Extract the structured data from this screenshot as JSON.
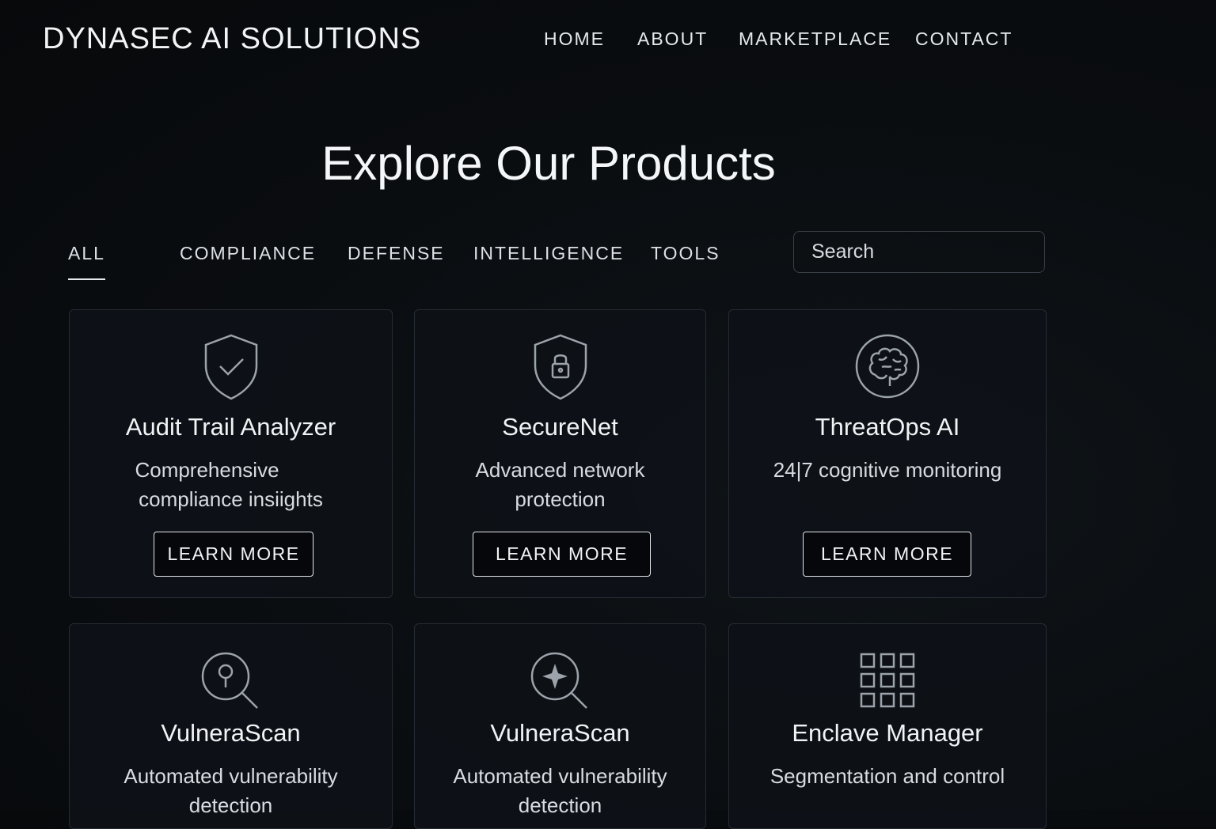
{
  "header": {
    "brand": "DYNASEC AI SOLUTIONS",
    "nav": [
      "HOME",
      "ABOUT",
      "MARKETPLACE",
      "CONTACT"
    ]
  },
  "main": {
    "title": "Explore Our Products",
    "filters": [
      "ALL",
      "COMPLIANCE",
      "DEFENSE",
      "INTELLIGENCE",
      "TOOLS"
    ],
    "active_filter": "ALL",
    "search": {
      "placeholder": "Search",
      "value": ""
    },
    "products": [
      {
        "name": "Audit Trail Analyzer",
        "desc_line1": "Comprehensive",
        "desc_line2": "compliance insiights",
        "button": "LEARN MORE",
        "icon": "shield-check-icon"
      },
      {
        "name": "SecureNet",
        "desc_line1": "Advanced network",
        "desc_line2": "protection",
        "button": "LEARN MORE",
        "icon": "shield-lock-icon"
      },
      {
        "name": "ThreatOps AI",
        "desc_line1": "24|7 cognitive monitoring",
        "desc_line2": "",
        "button": "LEARN MORE",
        "icon": "brain-icon"
      },
      {
        "name": "VulneraScan",
        "desc_line1": "Automated vulnerability",
        "desc_line2": "detection",
        "icon": "magnifier-pin-icon"
      },
      {
        "name": "VulneraScan",
        "desc_line1": "Automated vulnerability",
        "desc_line2": "detection",
        "icon": "magnifier-star-icon"
      },
      {
        "name": "Enclave Manager",
        "desc_line1": "Segmentation and control",
        "desc_line2": "",
        "icon": "grid-icon"
      }
    ]
  },
  "colors": {
    "background": "#0a0d10",
    "card_border": "#262c33",
    "text": "#e9ecef",
    "icon_stroke": "#9ca3aa"
  }
}
